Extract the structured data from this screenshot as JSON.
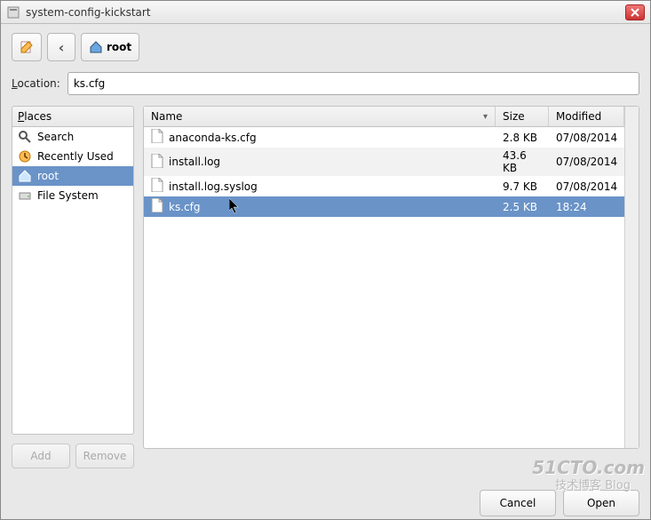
{
  "window": {
    "title": "system-config-kickstart"
  },
  "toolbar": {
    "back_glyph": "‹",
    "path_label": "root"
  },
  "location": {
    "label_prefix": "L",
    "label_rest": "ocation:",
    "value": "ks.cfg"
  },
  "places": {
    "header_first": "P",
    "header_rest": "laces",
    "items": [
      {
        "label": "Search",
        "icon": "search",
        "selected": false
      },
      {
        "label": "Recently Used",
        "icon": "recent",
        "selected": false
      },
      {
        "label": "root",
        "icon": "home",
        "selected": true
      },
      {
        "label": "File System",
        "icon": "drive",
        "selected": false
      }
    ],
    "add_label": "Add",
    "remove_label": "Remove"
  },
  "columns": {
    "name": "Name",
    "size": "Size",
    "modified": "Modified",
    "sort_glyph": "▾"
  },
  "files": [
    {
      "name": "anaconda-ks.cfg",
      "size": "2.8 KB",
      "modified": "07/08/2014",
      "selected": false,
      "alt": false
    },
    {
      "name": "install.log",
      "size": "43.6 KB",
      "modified": "07/08/2014",
      "selected": false,
      "alt": true
    },
    {
      "name": "install.log.syslog",
      "size": "9.7 KB",
      "modified": "07/08/2014",
      "selected": false,
      "alt": false
    },
    {
      "name": "ks.cfg",
      "size": "2.5 KB",
      "modified": "18:24",
      "selected": true,
      "alt": false
    }
  ],
  "buttons": {
    "cancel": "Cancel",
    "open": "Open"
  },
  "watermark": {
    "line1": "51CTO.com",
    "line2": "技术博客 Blog"
  }
}
